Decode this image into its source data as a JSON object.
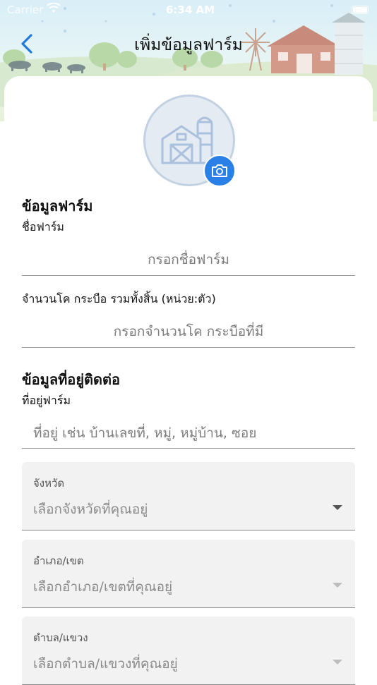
{
  "status_bar": {
    "carrier": "Carrier",
    "time": "6:34 AM"
  },
  "header": {
    "title": "เพิ่มข้อมูลฟาร์ม"
  },
  "icons": {
    "back": "chevron-left-icon",
    "avatar": "farm-barn-icon",
    "camera": "camera-icon",
    "dropdown": "triangle-down-icon"
  },
  "colors": {
    "accent": "#2a80e6",
    "back_arrow": "#1f7ae0"
  },
  "farm_info": {
    "section_title": "ข้อมูลฟาร์ม",
    "farm_name_label": "ชื่อฟาร์ม",
    "farm_name_placeholder": "กรอกชื่อฟาร์ม",
    "cattle_count_label": "จำนวนโค กระบือ รวมทั้งสิ้น (หน่วย:ตัว)",
    "cattle_count_placeholder": "กรอกจำนวนโค กระบือที่มี"
  },
  "contact_info": {
    "section_title": "ข้อมูลที่อยู่ติดต่อ",
    "address_label": "ที่อยู่ฟาร์ม",
    "address_placeholder": "ที่อยู่ เช่น บ้านเลขที่, หมู่, หมู่บ้าน, ซอย",
    "province": {
      "label": "จังหวัด",
      "placeholder": "เลือกจังหวัดที่คุณอยู่"
    },
    "district": {
      "label": "อำเภอ/เขต",
      "placeholder": "เลือกอำเภอ/เขตที่คุณอยู่"
    },
    "subdistrict": {
      "label": "ตำบล/แขวง",
      "placeholder": "เลือกตำบล/แขวงที่คุณอยู่"
    }
  }
}
